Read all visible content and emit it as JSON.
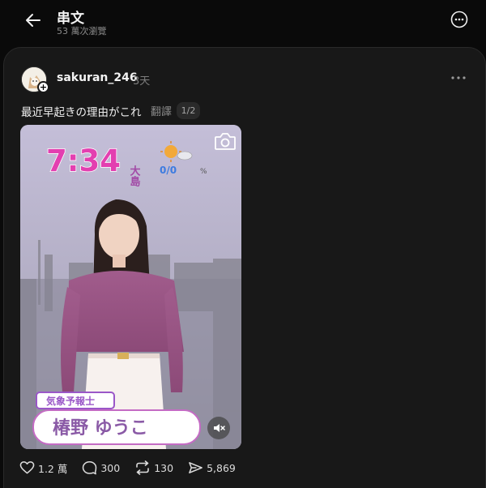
{
  "header": {
    "title": "串文",
    "views": "53 萬次瀏覽"
  },
  "post": {
    "username": "sakuran_246",
    "time": "3天",
    "text": "最近早起きの理由がこれ",
    "translate_label": "翻譯",
    "page_indicator": "1/2",
    "media": {
      "clock": "7:34",
      "city": "大島",
      "rain": "0/0",
      "rain_unit": "%",
      "caption_role": "気象予報士",
      "caption_name": "椿野 ゆうこ"
    }
  },
  "actions": {
    "likes": "1.2 萬",
    "comments": "300",
    "reposts": "130",
    "shares": "5,869"
  },
  "icons": {
    "back": "arrow-left-icon",
    "more": "more-circle-icon",
    "post_more": "ellipsis-icon",
    "camera": "camera-icon",
    "mute": "speaker-muted-icon",
    "like": "heart-icon",
    "comment": "comment-bubble-icon",
    "repost": "repost-icon",
    "share": "send-icon"
  },
  "colors": {
    "background": "#0a0a0a",
    "card": "#181818",
    "clock_pink": "#e33fb0",
    "caption_purple": "#9a57c8"
  }
}
